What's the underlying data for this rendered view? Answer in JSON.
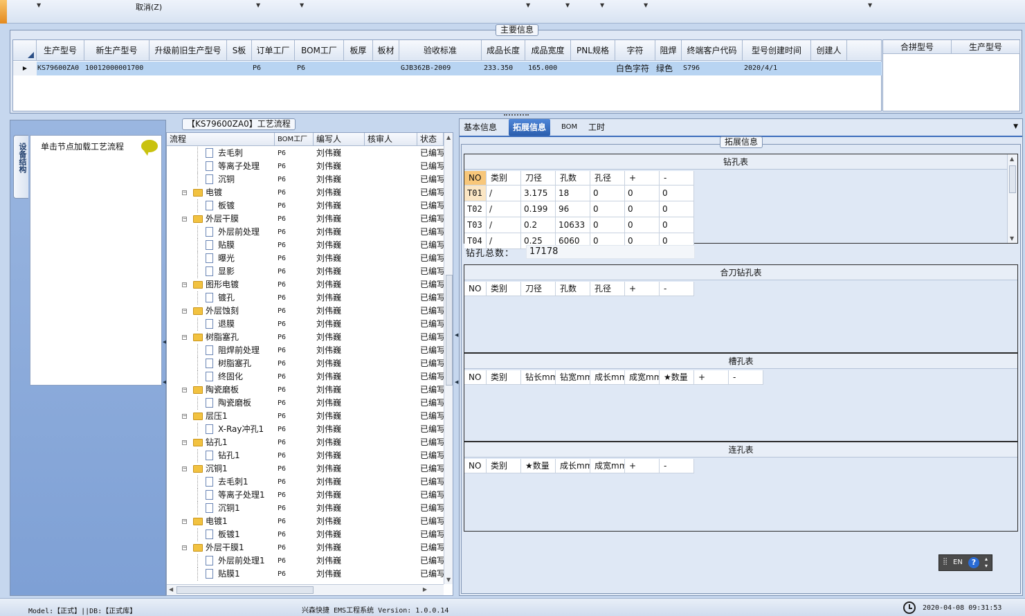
{
  "toolbar": {
    "cancel_label": "取消(Z)"
  },
  "main_info": {
    "title": "主要信息",
    "columns": [
      "生产型号",
      "新生产型号",
      "升级前旧生产型号",
      "S板",
      "订单工厂",
      "BOM工厂",
      "板厚",
      "板材",
      "验收标准",
      "成品长度",
      "成品宽度",
      "PNL规格",
      "字符",
      "阻焊",
      "终端客户代码",
      "型号创建时间",
      "创建人"
    ],
    "row": [
      "KS79600ZA0",
      "10012000001700",
      "",
      "",
      "P6",
      "P6",
      "",
      "",
      "GJB362B-2009",
      "233.350",
      "165.000",
      "",
      "白色字符",
      "绿色",
      "S796",
      "2020/4/1",
      ""
    ],
    "merge_columns": [
      "合拼型号",
      "生产型号"
    ]
  },
  "left": {
    "vtab_label": "设备结构",
    "node_hint": "单击节点加载工艺流程"
  },
  "process": {
    "title": "【KS79600ZA0】工艺流程",
    "columns": [
      "流程",
      "BOM工厂",
      "编写人",
      "核审人",
      "状态"
    ],
    "rows": [
      {
        "name": "去毛刺",
        "bom": "P6",
        "writer": "刘伟巍",
        "status": "已编写"
      },
      {
        "name": "等离子处理",
        "bom": "P6",
        "writer": "刘伟巍",
        "status": "已编写"
      },
      {
        "name": "沉铜",
        "bom": "P6",
        "writer": "刘伟巍",
        "status": "已编写"
      },
      {
        "name": "电镀",
        "bom": "P6",
        "writer": "刘伟巍",
        "status": "已编写"
      },
      {
        "name": "板镀",
        "bom": "P6",
        "writer": "刘伟巍",
        "status": "已编写"
      },
      {
        "name": "外层干膜",
        "bom": "P6",
        "writer": "刘伟巍",
        "status": "已编写"
      },
      {
        "name": "外层前处理",
        "bom": "P6",
        "writer": "刘伟巍",
        "status": "已编写"
      },
      {
        "name": "贴膜",
        "bom": "P6",
        "writer": "刘伟巍",
        "status": "已编写"
      },
      {
        "name": "曝光",
        "bom": "P6",
        "writer": "刘伟巍",
        "status": "已编写"
      },
      {
        "name": "显影",
        "bom": "P6",
        "writer": "刘伟巍",
        "status": "已编写"
      },
      {
        "name": "图形电镀",
        "bom": "P6",
        "writer": "刘伟巍",
        "status": "已编写"
      },
      {
        "name": "镀孔",
        "bom": "P6",
        "writer": "刘伟巍",
        "status": "已编写"
      },
      {
        "name": "外层蚀刻",
        "bom": "P6",
        "writer": "刘伟巍",
        "status": "已编写"
      },
      {
        "name": "退膜",
        "bom": "P6",
        "writer": "刘伟巍",
        "status": "已编写"
      },
      {
        "name": "树脂塞孔",
        "bom": "P6",
        "writer": "刘伟巍",
        "status": "已编写"
      },
      {
        "name": "阻焊前处理",
        "bom": "P6",
        "writer": "刘伟巍",
        "status": "已编写"
      },
      {
        "name": "树脂塞孔",
        "bom": "P6",
        "writer": "刘伟巍",
        "status": "已编写"
      },
      {
        "name": "终固化",
        "bom": "P6",
        "writer": "刘伟巍",
        "status": "已编写"
      },
      {
        "name": "陶瓷磨板",
        "bom": "P6",
        "writer": "刘伟巍",
        "status": "已编写"
      },
      {
        "name": "陶瓷磨板",
        "bom": "P6",
        "writer": "刘伟巍",
        "status": "已编写"
      },
      {
        "name": "层压1",
        "bom": "P6",
        "writer": "刘伟巍",
        "status": "已编写"
      },
      {
        "name": "X-Ray冲孔1",
        "bom": "P6",
        "writer": "刘伟巍",
        "status": "已编写"
      },
      {
        "name": "钻孔1",
        "bom": "P6",
        "writer": "刘伟巍",
        "status": "已编写"
      },
      {
        "name": "钻孔1",
        "bom": "P6",
        "writer": "刘伟巍",
        "status": "已编写"
      },
      {
        "name": "沉铜1",
        "bom": "P6",
        "writer": "刘伟巍",
        "status": "已编写"
      },
      {
        "name": "去毛刺1",
        "bom": "P6",
        "writer": "刘伟巍",
        "status": "已编写"
      },
      {
        "name": "等离子处理1",
        "bom": "P6",
        "writer": "刘伟巍",
        "status": "已编写"
      },
      {
        "name": "沉铜1",
        "bom": "P6",
        "writer": "刘伟巍",
        "status": "已编写"
      },
      {
        "name": "电镀1",
        "bom": "P6",
        "writer": "刘伟巍",
        "status": "已编写"
      },
      {
        "name": "板镀1",
        "bom": "P6",
        "writer": "刘伟巍",
        "status": "已编写"
      },
      {
        "name": "外层干膜1",
        "bom": "P6",
        "writer": "刘伟巍",
        "status": "已编写"
      },
      {
        "name": "外层前处理1",
        "bom": "P6",
        "writer": "刘伟巍",
        "status": "已编写"
      },
      {
        "name": "贴膜1",
        "bom": "P6",
        "writer": "刘伟巍",
        "status": "已编写"
      }
    ]
  },
  "right": {
    "tabs": [
      "基本信息",
      "拓展信息",
      "BOM",
      "工时"
    ],
    "active_tab": "拓展信息",
    "ext_title": "拓展信息",
    "drill": {
      "title": "钻孔表",
      "columns": [
        "NO",
        "类别",
        "刀径",
        "孔数",
        "孔径",
        "+",
        "-"
      ],
      "rows": [
        [
          "T01",
          "/",
          "3.175",
          "18",
          "0",
          "0",
          "0"
        ],
        [
          "T02",
          "/",
          "0.199",
          "96",
          "0",
          "0",
          "0"
        ],
        [
          "T03",
          "/",
          "0.2",
          "10633",
          "0",
          "0",
          "0"
        ],
        [
          "T04",
          "/",
          "0.25",
          "6060",
          "0",
          "0",
          "0"
        ]
      ],
      "total_label": "钻孔总数：",
      "total_value": "17178"
    },
    "combo": {
      "title": "合刀钻孔表",
      "columns": [
        "NO",
        "类别",
        "刀径",
        "孔数",
        "孔径",
        "+",
        "-"
      ]
    },
    "slot": {
      "title": "槽孔表",
      "columns": [
        "NO",
        "类别",
        "钻长mm",
        "钻宽mm",
        "成长mm",
        "成宽mm",
        "★数量",
        "+",
        "-"
      ]
    },
    "link": {
      "title": "连孔表",
      "columns": [
        "NO",
        "类别",
        "★数量",
        "成长mm",
        "成宽mm",
        "+",
        "-"
      ]
    }
  },
  "lang": {
    "label": "EN"
  },
  "status": {
    "model": "Model:【正式】||DB:【正式库】",
    "app": "兴森快捷 EMS工程系统 Version: 1.0.0.14",
    "datetime": "2020-04-08 09:31:53"
  }
}
